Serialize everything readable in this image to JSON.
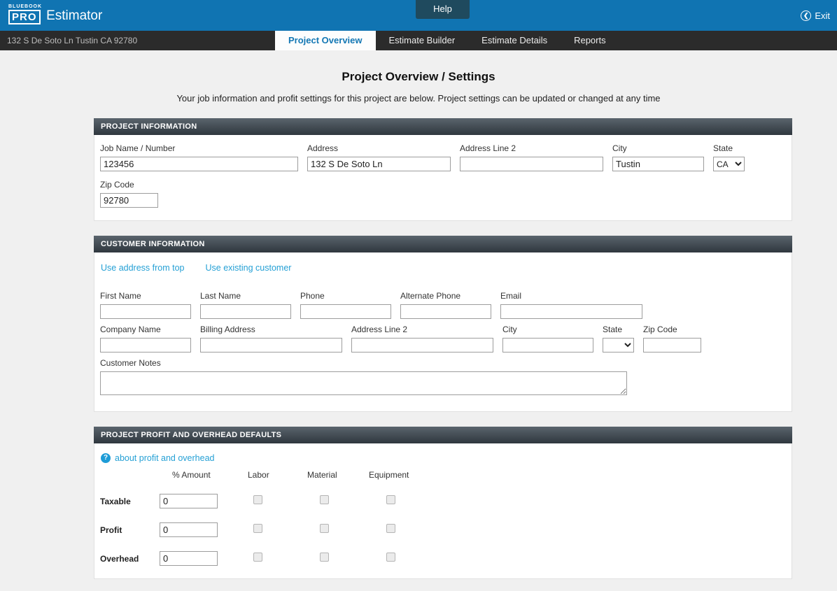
{
  "topbar": {
    "brand_small": "BLUEBOOK",
    "brand_pro": "PRO",
    "brand_name": "Estimator",
    "help_label": "Help",
    "exit_label": "Exit"
  },
  "navbar": {
    "address": "132 S De Soto Ln Tustin CA 92780",
    "tabs": [
      {
        "label": "Project Overview",
        "active": true
      },
      {
        "label": "Estimate Builder",
        "active": false
      },
      {
        "label": "Estimate Details",
        "active": false
      },
      {
        "label": "Reports",
        "active": false
      }
    ]
  },
  "page": {
    "title": "Project Overview / Settings",
    "subtitle": "Your job information and profit settings for this project are below. Project settings can be updated or changed at any time"
  },
  "project_information": {
    "header": "PROJECT INFORMATION",
    "job_name_label": "Job Name / Number",
    "job_name_value": "123456",
    "address_label": "Address",
    "address_value": "132 S De Soto Ln",
    "address2_label": "Address Line 2",
    "address2_value": "",
    "city_label": "City",
    "city_value": "Tustin",
    "state_label": "State",
    "state_value": "CA",
    "zip_label": "Zip Code",
    "zip_value": "92780"
  },
  "customer_information": {
    "header": "CUSTOMER INFORMATION",
    "link_use_address": "Use address from top",
    "link_use_existing": "Use existing customer",
    "first_name_label": "First Name",
    "first_name_value": "",
    "last_name_label": "Last Name",
    "last_name_value": "",
    "phone_label": "Phone",
    "phone_value": "",
    "alt_phone_label": "Alternate Phone",
    "alt_phone_value": "",
    "email_label": "Email",
    "email_value": "",
    "company_label": "Company Name",
    "company_value": "",
    "billing_label": "Billing Address",
    "billing_value": "",
    "address2_label": "Address Line 2",
    "address2_value": "",
    "city_label": "City",
    "city_value": "",
    "state_label": "State",
    "state_value": "",
    "zip_label": "Zip Code",
    "zip_value": "",
    "notes_label": "Customer Notes",
    "notes_value": ""
  },
  "profit_overhead": {
    "header": "PROJECT PROFIT AND OVERHEAD DEFAULTS",
    "about_link": "about profit and overhead",
    "columns": [
      "% Amount",
      "Labor",
      "Material",
      "Equipment"
    ],
    "rows": [
      {
        "label": "Taxable",
        "amount": "0",
        "labor_checked": false,
        "material_checked": false,
        "equipment_checked": false
      },
      {
        "label": "Profit",
        "amount": "0",
        "labor_checked": false,
        "material_checked": false,
        "equipment_checked": false
      },
      {
        "label": "Overhead",
        "amount": "0",
        "labor_checked": false,
        "material_checked": false,
        "equipment_checked": false
      }
    ]
  }
}
